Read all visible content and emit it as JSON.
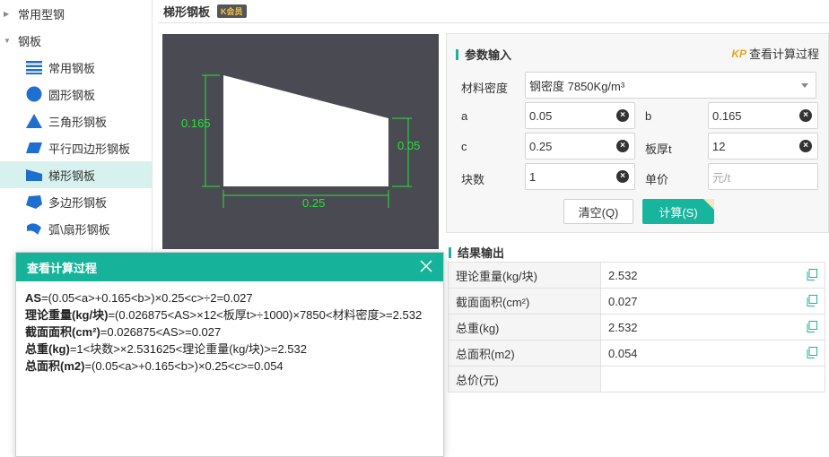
{
  "sidebar": {
    "categories": [
      {
        "label": "常用型钢",
        "expanded": false
      },
      {
        "label": "钢板",
        "expanded": true
      }
    ],
    "items": [
      {
        "label": "常用钢板",
        "icon": "lines-icon"
      },
      {
        "label": "圆形钢板",
        "icon": "circle-icon"
      },
      {
        "label": "三角形钢板",
        "icon": "triangle-icon"
      },
      {
        "label": "平行四边形钢板",
        "icon": "parallelogram-icon"
      },
      {
        "label": "梯形钢板",
        "icon": "trapezoid-icon",
        "active": true
      },
      {
        "label": "多边形钢板",
        "icon": "polygon-icon"
      },
      {
        "label": "弧\\扇形钢板",
        "icon": "sector-icon"
      }
    ]
  },
  "header": {
    "title": "梯形钢板",
    "badge": "K会员"
  },
  "diagram": {
    "left_height": "0.165",
    "right_height": "0.05",
    "width": "0.25"
  },
  "params": {
    "title": "参数输入",
    "view_process_link": "查看计算过程",
    "link_icon_text": "KP",
    "material_label": "材料密度",
    "material_value": "钢密度 7850Kg/m³",
    "a_label": "a",
    "a_value": "0.05",
    "b_label": "b",
    "b_value": "0.165",
    "c_label": "c",
    "c_value": "0.25",
    "t_label": "板厚t",
    "t_value": "12",
    "count_label": "块数",
    "count_value": "1",
    "price_label": "单价",
    "price_placeholder": "元/t",
    "clear_button": "清空(Q)",
    "calc_button": "计算(S)"
  },
  "results": {
    "title": "结果输出",
    "rows": [
      {
        "label": "理论重量(kg/块)",
        "value": "2.532"
      },
      {
        "label": "截面面积(cm²)",
        "value": "0.027"
      },
      {
        "label": "总重(kg)",
        "value": "2.532"
      },
      {
        "label": "总面积(m2)",
        "value": "0.054"
      },
      {
        "label": "总价(元)",
        "value": ""
      }
    ]
  },
  "dialog": {
    "title": "查看计算过程",
    "lines": [
      {
        "key": "AS",
        "text": "=(0.05<a>+0.165<b>)×0.25<c>÷2=0.027"
      },
      {
        "key": "理论重量(kg/块)",
        "text": "=(0.026875<AS>×12<板厚t>÷1000)×7850<材料密度>=2.532"
      },
      {
        "key": "截面面积(cm²)",
        "text": "=0.026875<AS>=0.027"
      },
      {
        "key": "总重(kg)",
        "text": "=1<块数>×2.531625<理论重量(kg/块)>=2.532"
      },
      {
        "key": "总面积(m2)",
        "text": "=(0.05<a>+0.165<b>)×0.25<c>=0.054"
      }
    ]
  },
  "colors": {
    "accent": "#18b59e",
    "diagram_bg": "#4a4b52",
    "dimension": "#28e038"
  }
}
